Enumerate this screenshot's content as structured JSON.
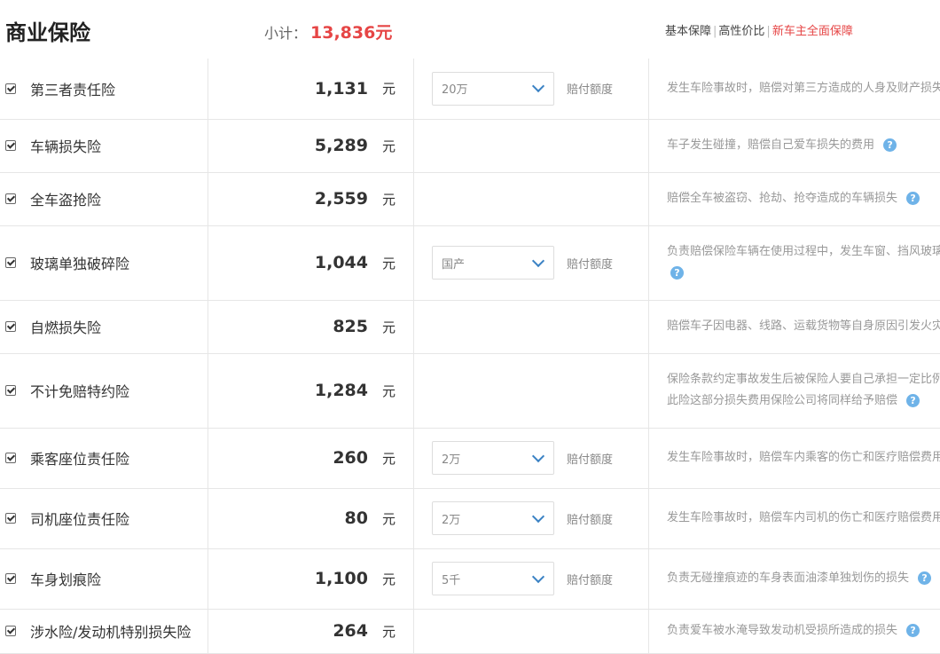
{
  "header": {
    "title": "商业保险",
    "subtotal_label": "小计：",
    "subtotal_value": "13,836元",
    "plans": [
      "基本保障",
      "高性价比",
      "新车主全面保障"
    ],
    "separator": "|"
  },
  "limit_label": "赔付额度",
  "help_icon": "?",
  "rows": [
    {
      "name": "第三者责任险",
      "premium": "1,131",
      "unit": "元",
      "select": "20万",
      "desc": [
        "发生车险事故时，赔偿对第三方造成的人身及财产损失"
      ],
      "help": false
    },
    {
      "name": "车辆损失险",
      "premium": "5,289",
      "unit": "元",
      "select": null,
      "desc": [
        "车子发生碰撞，赔偿自己爱车损失的费用"
      ],
      "help": true
    },
    {
      "name": "全车盗抢险",
      "premium": "2,559",
      "unit": "元",
      "select": null,
      "desc": [
        "赔偿全车被盗窃、抢劫、抢夺造成的车辆损失"
      ],
      "help": true
    },
    {
      "name": "玻璃单独破碎险",
      "premium": "1,044",
      "unit": "元",
      "select": "国产",
      "desc": [
        "负责赔偿保险车辆在使用过程中，发生车窗、挡风玻璃"
      ],
      "help": true,
      "help_newline": true
    },
    {
      "name": "自燃损失险",
      "premium": "825",
      "unit": "元",
      "select": null,
      "desc": [
        "赔偿车子因电器、线路、运载货物等自身原因引发火灾"
      ],
      "help": false
    },
    {
      "name": "不计免赔特约险",
      "premium": "1,284",
      "unit": "元",
      "select": null,
      "desc": [
        "保险条款约定事故发生后被保险人要自己承担一定比例",
        "此险这部分损失费用保险公司将同样给予赔偿"
      ],
      "help": true
    },
    {
      "name": "乘客座位责任险",
      "premium": "260",
      "unit": "元",
      "select": "2万",
      "desc": [
        "发生车险事故时，赔偿车内乘客的伤亡和医疗赔偿费用"
      ],
      "help": false
    },
    {
      "name": "司机座位责任险",
      "premium": "80",
      "unit": "元",
      "select": "2万",
      "desc": [
        "发生车险事故时，赔偿车内司机的伤亡和医疗赔偿费用"
      ],
      "help": false
    },
    {
      "name": "车身划痕险",
      "premium": "1,100",
      "unit": "元",
      "select": "5千",
      "desc": [
        "负责无碰撞痕迹的车身表面油漆单独划伤的损失"
      ],
      "help": true
    },
    {
      "name": "涉水险/发动机特别损失险",
      "premium": "264",
      "unit": "元",
      "select": null,
      "desc": [
        "负责爱车被水淹导致发动机受损所造成的损失"
      ],
      "help": true
    }
  ]
}
